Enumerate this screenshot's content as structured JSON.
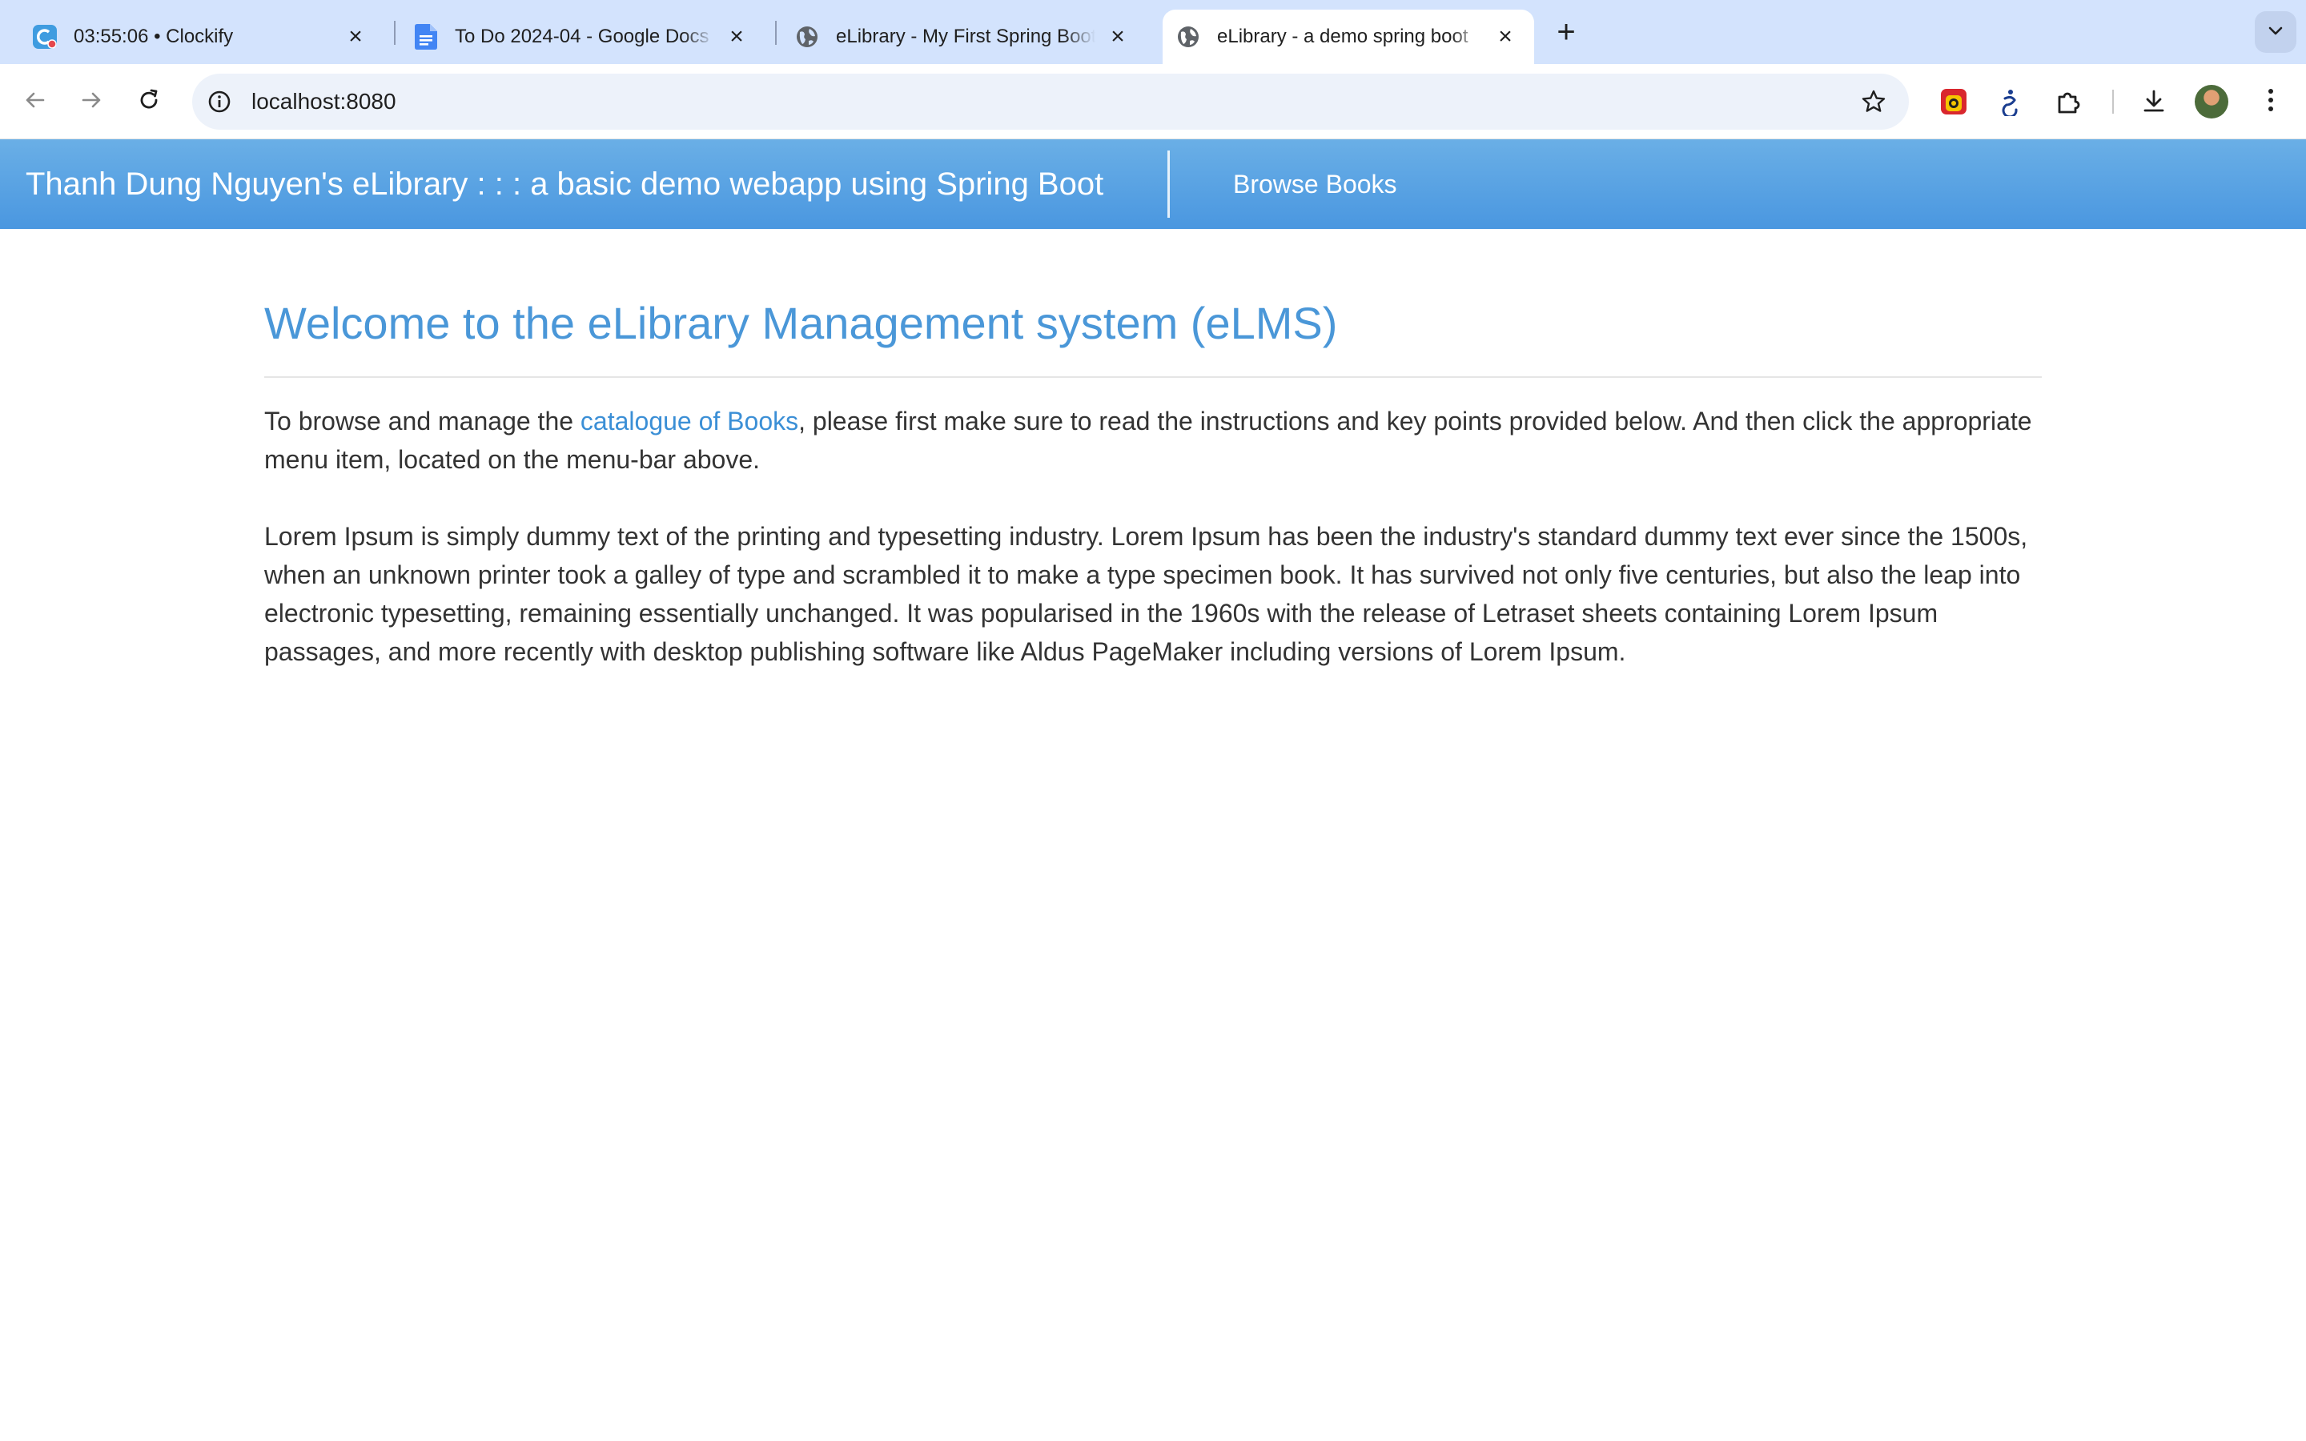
{
  "browser": {
    "tabs": [
      {
        "title": "03:55:06 • Clockify",
        "icon": "clockify-icon",
        "active": false
      },
      {
        "title": "To Do 2024-04 - Google Docs",
        "icon": "google-docs-icon",
        "active": false
      },
      {
        "title": "eLibrary - My First Spring Boot",
        "icon": "globe-icon",
        "active": false
      },
      {
        "title": "eLibrary - a demo spring boot",
        "icon": "globe-icon",
        "active": true
      }
    ],
    "new_tab_label": "+",
    "address_bar": {
      "url": "localhost:8080"
    },
    "colors": {
      "tab_strip": "#d3e3fd",
      "omnibox": "#edf2fa"
    }
  },
  "app": {
    "brand": "Thanh Dung Nguyen's eLibrary : : : a basic demo webapp using Spring Boot",
    "nav": [
      {
        "label": "Browse Books"
      }
    ],
    "colors": {
      "navbar": "#4a97e0",
      "heading": "#4a97d8",
      "link": "#3b8fd6"
    }
  },
  "main": {
    "heading": "Welcome to the eLibrary Management system (eLMS)",
    "intro": {
      "before_link": "To browse and manage the ",
      "link_text": "catalogue of Books",
      "after_link": ", please first make sure to read the instructions and key points provided below. And then click the appropriate menu item, located on the menu-bar above."
    },
    "lorem": "Lorem Ipsum is simply dummy text of the printing and typesetting industry. Lorem Ipsum has been the industry's standard dummy text ever since the 1500s, when an unknown printer took a galley of type and scrambled it to make a type specimen book. It has survived not only five centuries, but also the leap into electronic typesetting, remaining essentially unchanged. It was popularised in the 1960s with the release of Letraset sheets containing Lorem Ipsum passages, and more recently with desktop publishing software like Aldus PageMaker including versions of Lorem Ipsum."
  }
}
